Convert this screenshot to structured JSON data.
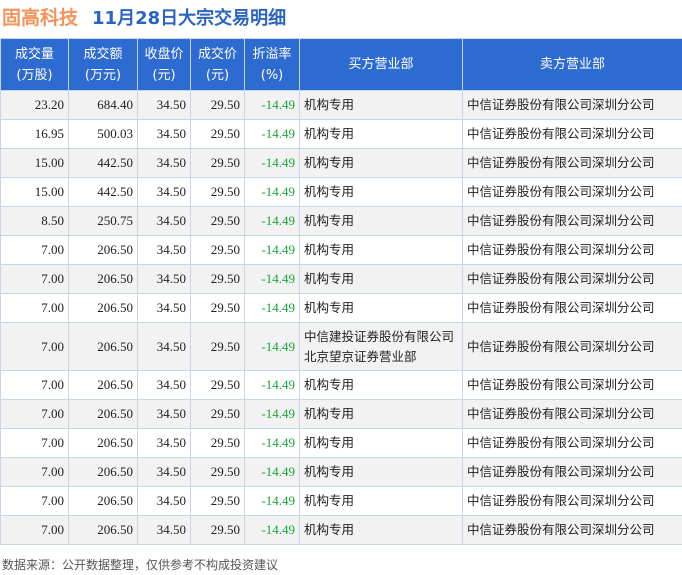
{
  "title": {
    "stock": "固高科技",
    "subtitle": "11月28日大宗交易明细"
  },
  "headers": [
    [
      "成交量",
      "(万股)"
    ],
    [
      "成交额",
      "(万元)"
    ],
    [
      "收盘价",
      "(元)"
    ],
    [
      "成交价",
      "(元)"
    ],
    [
      "折溢率",
      "(%)"
    ],
    [
      "买方营业部",
      ""
    ],
    [
      "卖方营业部",
      ""
    ]
  ],
  "rows": [
    [
      "23.20",
      "684.40",
      "34.50",
      "29.50",
      "-14.49",
      "机构专用",
      "中信证券股份有限公司深圳分公司"
    ],
    [
      "16.95",
      "500.03",
      "34.50",
      "29.50",
      "-14.49",
      "机构专用",
      "中信证券股份有限公司深圳分公司"
    ],
    [
      "15.00",
      "442.50",
      "34.50",
      "29.50",
      "-14.49",
      "机构专用",
      "中信证券股份有限公司深圳分公司"
    ],
    [
      "15.00",
      "442.50",
      "34.50",
      "29.50",
      "-14.49",
      "机构专用",
      "中信证券股份有限公司深圳分公司"
    ],
    [
      "8.50",
      "250.75",
      "34.50",
      "29.50",
      "-14.49",
      "机构专用",
      "中信证券股份有限公司深圳分公司"
    ],
    [
      "7.00",
      "206.50",
      "34.50",
      "29.50",
      "-14.49",
      "机构专用",
      "中信证券股份有限公司深圳分公司"
    ],
    [
      "7.00",
      "206.50",
      "34.50",
      "29.50",
      "-14.49",
      "机构专用",
      "中信证券股份有限公司深圳分公司"
    ],
    [
      "7.00",
      "206.50",
      "34.50",
      "29.50",
      "-14.49",
      "机构专用",
      "中信证券股份有限公司深圳分公司"
    ],
    [
      "7.00",
      "206.50",
      "34.50",
      "29.50",
      "-14.49",
      "中信建投证券股份有限公司北京望京证券营业部",
      "中信证券股份有限公司深圳分公司"
    ],
    [
      "7.00",
      "206.50",
      "34.50",
      "29.50",
      "-14.49",
      "机构专用",
      "中信证券股份有限公司深圳分公司"
    ],
    [
      "7.00",
      "206.50",
      "34.50",
      "29.50",
      "-14.49",
      "机构专用",
      "中信证券股份有限公司深圳分公司"
    ],
    [
      "7.00",
      "206.50",
      "34.50",
      "29.50",
      "-14.49",
      "机构专用",
      "中信证券股份有限公司深圳分公司"
    ],
    [
      "7.00",
      "206.50",
      "34.50",
      "29.50",
      "-14.49",
      "机构专用",
      "中信证券股份有限公司深圳分公司"
    ],
    [
      "7.00",
      "206.50",
      "34.50",
      "29.50",
      "-14.49",
      "机构专用",
      "中信证券股份有限公司深圳分公司"
    ],
    [
      "7.00",
      "206.50",
      "34.50",
      "29.50",
      "-14.49",
      "机构专用",
      "中信证券股份有限公司深圳分公司"
    ]
  ],
  "footer": "数据来源：公开数据整理，仅供参考不构成投资建议"
}
